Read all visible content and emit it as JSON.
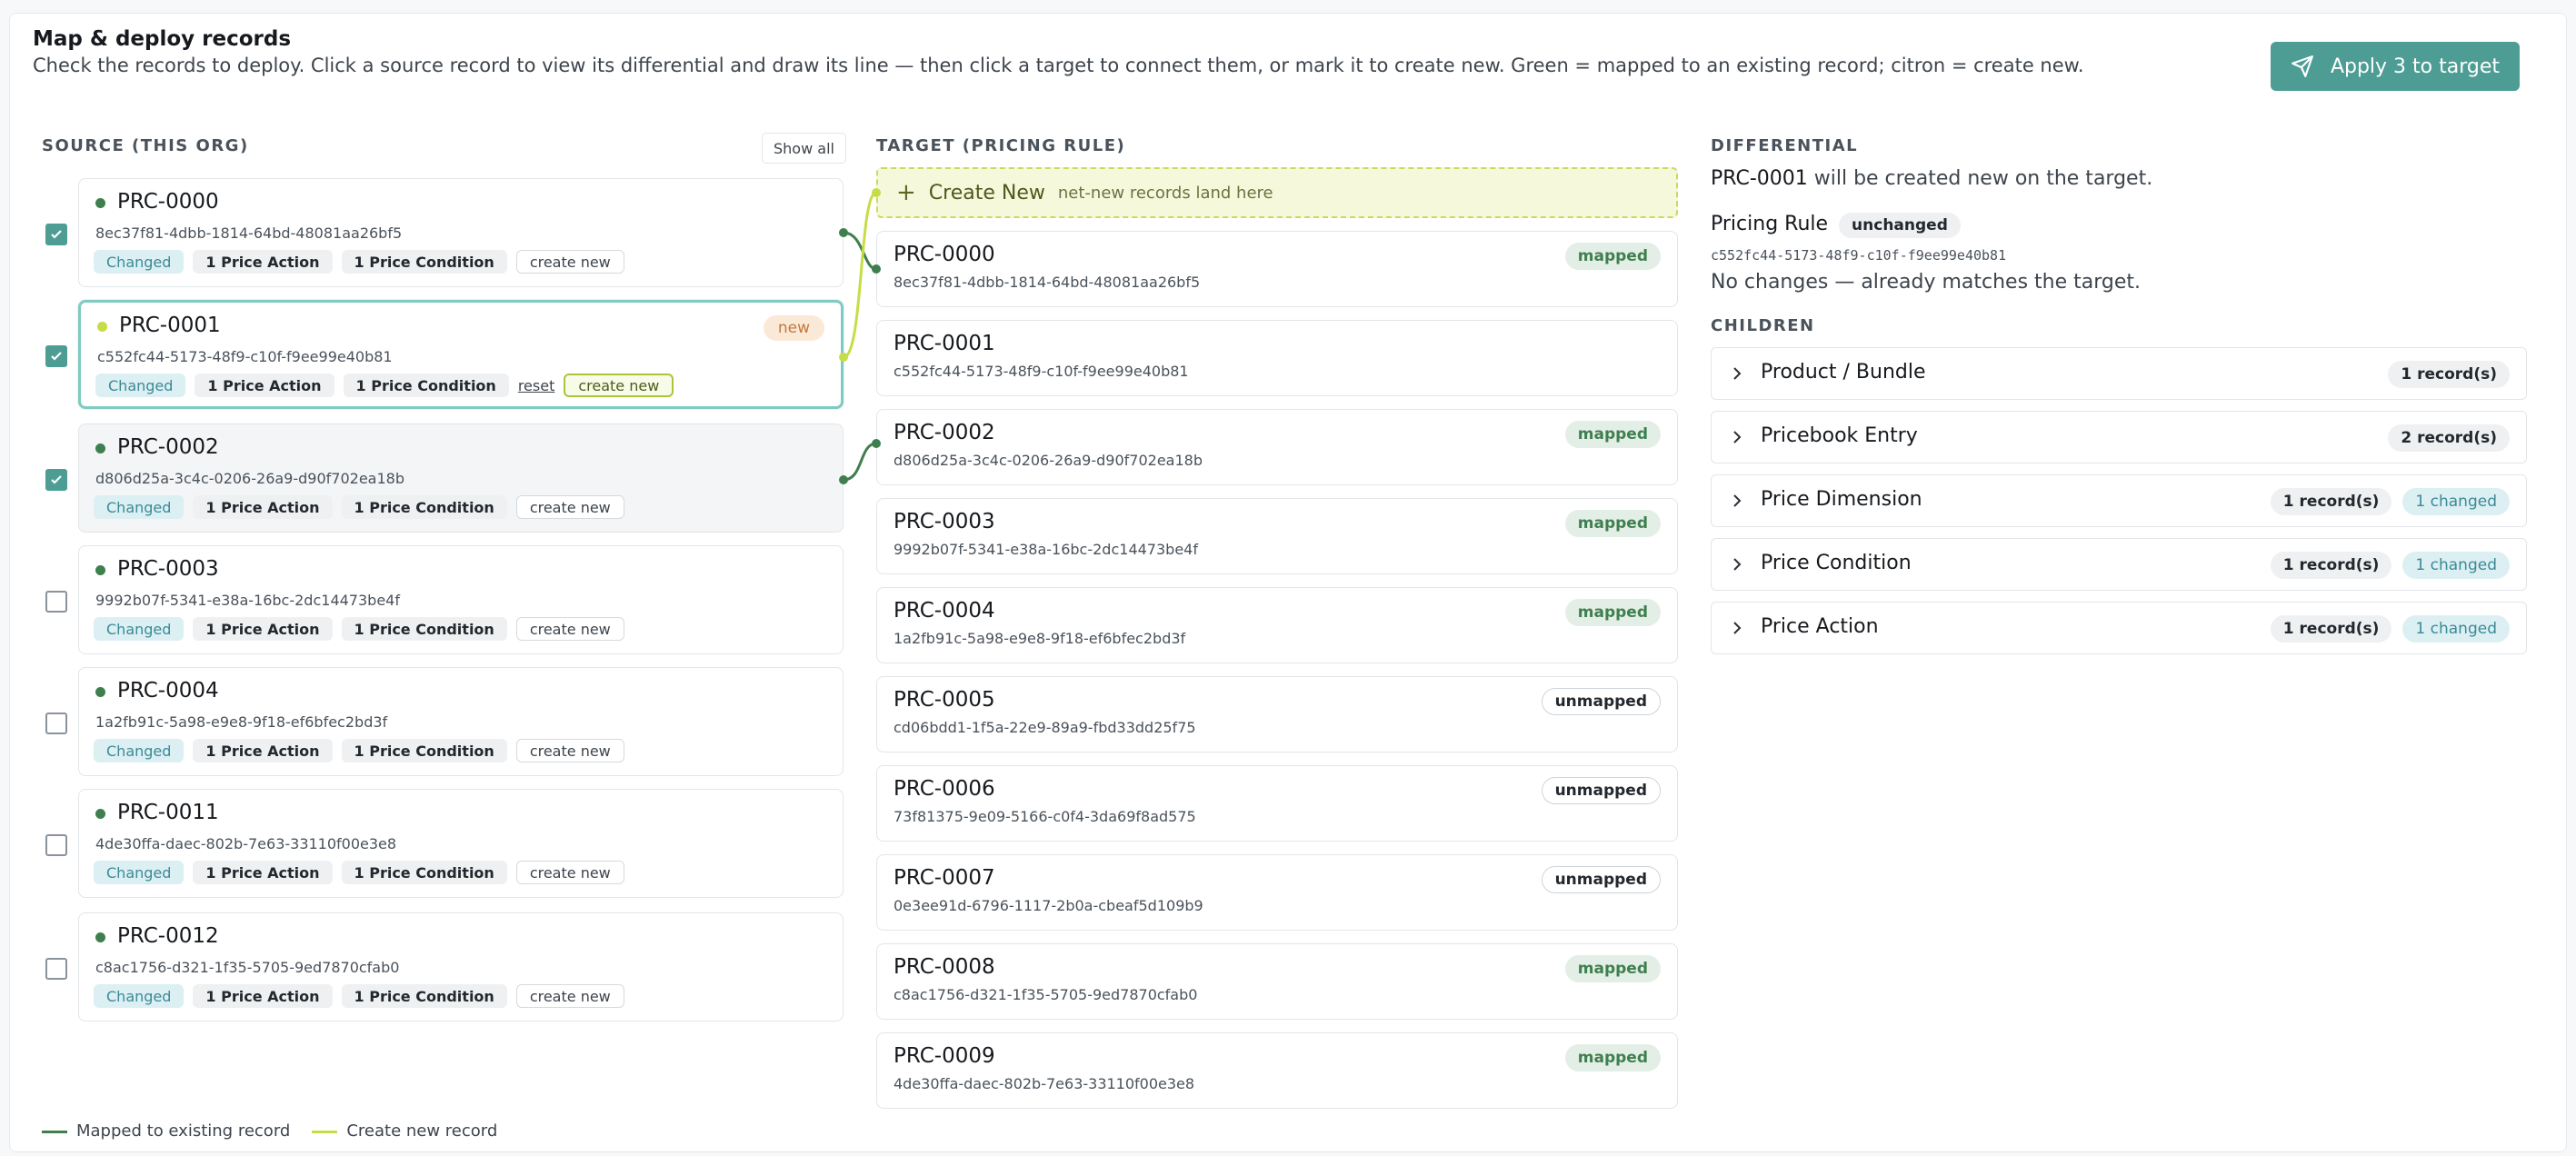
{
  "header": {
    "title": "Map & deploy records",
    "subtitle": "Check the records to deploy. Click a source record to view its differential and draw its line — then click a target to connect them, or mark it to create new. Green = mapped to an existing record; citron = create new.",
    "apply_label": "Apply 3 to target"
  },
  "columns": {
    "source_label": "SOURCE (THIS ORG)",
    "show_all": "Show all",
    "target_label": "TARGET (PRICING RULE)",
    "differential_label": "DIFFERENTIAL"
  },
  "source": [
    {
      "name": "PRC-0000",
      "id": "8ec37f81-4dbb-1814-64bd-48081aa26bf5",
      "checked": true,
      "changed": "Changed",
      "actions": "1 Price Action",
      "conditions": "1 Price Condition",
      "create": "create new"
    },
    {
      "name": "PRC-0001",
      "id": "c552fc44-5173-48f9-c10f-f9ee99e40b81",
      "checked": true,
      "changed": "Changed",
      "actions": "1 Price Action",
      "conditions": "1 Price Condition",
      "create": "create new",
      "reset": "reset",
      "badge": "new"
    },
    {
      "name": "PRC-0002",
      "id": "d806d25a-3c4c-0206-26a9-d90f702ea18b",
      "checked": true,
      "changed": "Changed",
      "actions": "1 Price Action",
      "conditions": "1 Price Condition",
      "create": "create new"
    },
    {
      "name": "PRC-0003",
      "id": "9992b07f-5341-e38a-16bc-2dc14473be4f",
      "checked": false,
      "changed": "Changed",
      "actions": "1 Price Action",
      "conditions": "1 Price Condition",
      "create": "create new"
    },
    {
      "name": "PRC-0004",
      "id": "1a2fb91c-5a98-e9e8-9f18-ef6bfec2bd3f",
      "checked": false,
      "changed": "Changed",
      "actions": "1 Price Action",
      "conditions": "1 Price Condition",
      "create": "create new"
    },
    {
      "name": "PRC-0011",
      "id": "4de30ffa-daec-802b-7e63-33110f00e3e8",
      "checked": false,
      "changed": "Changed",
      "actions": "1 Price Action",
      "conditions": "1 Price Condition",
      "create": "create new"
    },
    {
      "name": "PRC-0012",
      "id": "c8ac1756-d321-1f35-5705-9ed7870cfab0",
      "checked": false,
      "changed": "Changed",
      "actions": "1 Price Action",
      "conditions": "1 Price Condition",
      "create": "create new"
    }
  ],
  "create_new": {
    "label": "Create New",
    "sub": "net-new records land here"
  },
  "target": [
    {
      "name": "PRC-0000",
      "id": "8ec37f81-4dbb-1814-64bd-48081aa26bf5",
      "status": "mapped"
    },
    {
      "name": "PRC-0001",
      "id": "c552fc44-5173-48f9-c10f-f9ee99e40b81",
      "status": ""
    },
    {
      "name": "PRC-0002",
      "id": "d806d25a-3c4c-0206-26a9-d90f702ea18b",
      "status": "mapped"
    },
    {
      "name": "PRC-0003",
      "id": "9992b07f-5341-e38a-16bc-2dc14473be4f",
      "status": "mapped"
    },
    {
      "name": "PRC-0004",
      "id": "1a2fb91c-5a98-e9e8-9f18-ef6bfec2bd3f",
      "status": "mapped"
    },
    {
      "name": "PRC-0005",
      "id": "cd06bdd1-1f5a-22e9-89a9-fbd33dd25f75",
      "status": "unmapped"
    },
    {
      "name": "PRC-0006",
      "id": "73f81375-9e09-5166-c0f4-3da69f8ad575",
      "status": "unmapped"
    },
    {
      "name": "PRC-0007",
      "id": "0e3ee91d-6796-1117-2b0a-cbeaf5d109b9",
      "status": "unmapped"
    },
    {
      "name": "PRC-0008",
      "id": "c8ac1756-d321-1f35-5705-9ed7870cfab0",
      "status": "mapped"
    },
    {
      "name": "PRC-0009",
      "id": "4de30ffa-daec-802b-7e63-33110f00e3e8",
      "status": "mapped"
    }
  ],
  "differential": {
    "record": "PRC-0001",
    "message": " will be created new on the target.",
    "object": "Pricing Rule",
    "object_status": "unchanged",
    "object_id": "c552fc44-5173-48f9-c10f-f9ee99e40b81",
    "note": "No changes — already matches the target.",
    "children_label": "CHILDREN",
    "children": [
      {
        "name": "Product / Bundle",
        "records": "1 record(s)",
        "changed": ""
      },
      {
        "name": "Pricebook Entry",
        "records": "2 record(s)",
        "changed": ""
      },
      {
        "name": "Price Dimension",
        "records": "1 record(s)",
        "changed": "1 changed"
      },
      {
        "name": "Price Condition",
        "records": "1 record(s)",
        "changed": "1 changed"
      },
      {
        "name": "Price Action",
        "records": "1 record(s)",
        "changed": "1 changed"
      }
    ]
  },
  "legend": {
    "mapped": "Mapped to existing record",
    "create": "Create new record",
    "mapped_color": "#3f7f4f",
    "create_color": "#c8dc45"
  },
  "icons": {
    "apply": "send-icon",
    "chevron": "chevron-right-icon",
    "plus": "plus-icon",
    "check": "check-icon"
  }
}
